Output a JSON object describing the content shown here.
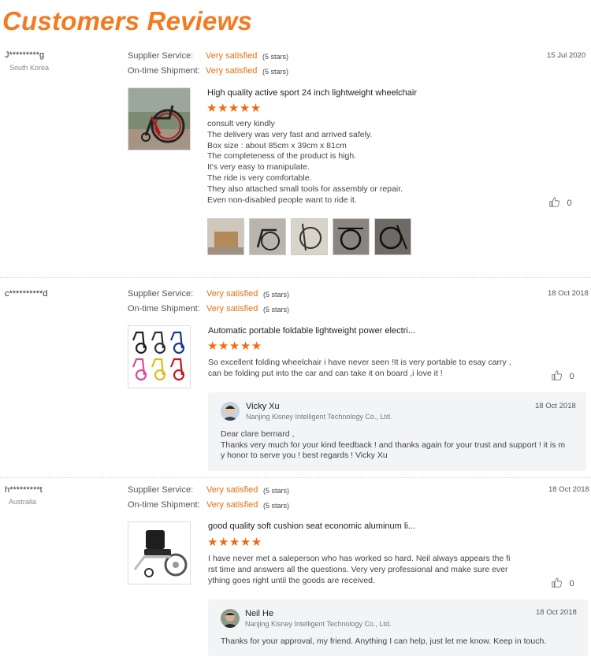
{
  "page_title": "Customers Reviews",
  "reviews": [
    {
      "user": "J*********g",
      "country": "South Korea",
      "supplier_label": "Supplier Service:",
      "supplier_value": "Very satisfied",
      "supplier_stars": "(5 stars)",
      "shipment_label": "On-time Shipment:",
      "shipment_value": "Very satisfied",
      "shipment_stars": "(5 stars)",
      "date": "15 Jul 2020",
      "product_title": "High quality active sport 24 inch lightweight wheelchair",
      "rating": "★★★★★",
      "rating_value": 5,
      "lines": [
        "consult very kindly",
        "The delivery was very fast and arrived safely.",
        "Box size : about 85cm x 39cm x 81cm",
        "The completeness of the product is high.",
        "It's very easy to manipulate.",
        "The ride is very comfortable.",
        "They also attached small tools for assembly or repair.",
        "Even non-disabled people want to ride it."
      ],
      "likes": "0"
    },
    {
      "user": "c**********d",
      "supplier_label": "Supplier Service:",
      "supplier_value": "Very satisfied",
      "supplier_stars": "(5 stars)",
      "shipment_label": "On-time Shipment:",
      "shipment_value": "Very satisfied",
      "shipment_stars": "(5 stars)",
      "date": "18 Oct 2018",
      "product_title": "Automatic portable foldable lightweight power electri...",
      "rating": "★★★★★",
      "rating_value": 5,
      "lines": [
        "So excellent folding wheelchair i have never seen !It is very portable to esay carry ,",
        "can be folding put into the car and can take it on board ,i love it !"
      ],
      "likes": "0",
      "reply": {
        "name": "Vicky Xu",
        "company": "Nanjing Kisney Intelligent Technology Co., Ltd.",
        "date": "18 Oct 2018",
        "lines": [
          "Dear clare bernard ,",
          "Thanks very much for your kind feedback ! and thanks again for your trust and support ! it is m",
          "y honor to serve you ! best regards ! Vicky Xu"
        ]
      }
    },
    {
      "user": "h*********t",
      "country": "Australia",
      "supplier_label": "Supplier Service:",
      "supplier_value": "Very satisfied",
      "supplier_stars": "(5 stars)",
      "shipment_label": "On-time Shipment:",
      "shipment_value": "Very satisfied",
      "shipment_stars": "(5 stars)",
      "date": "18 Oct 2018",
      "product_title": "good quality soft cushion seat economic aluminum li...",
      "rating": "★★★★★",
      "rating_value": 5,
      "lines": [
        "I have never met a saleperson who has worked so hard. Neil always appears the fi",
        "rst time and answers all the questions. Very very professional and make sure ever",
        "ything goes right until the goods are received."
      ],
      "likes": "0",
      "reply": {
        "name": "Neil He",
        "company": "Nanjing Kisney Intelligent Technology Co., Ltd.",
        "date": "18 Oct 2018",
        "lines": [
          "Thanks for your approval, my friend.  Anything I can help, just let me know. Keep in touch."
        ]
      }
    }
  ],
  "icons": {
    "like": "thumbs-up-icon",
    "star": "star-icon"
  },
  "colors": {
    "accent": "#f47a1f",
    "star": "#f26a0f",
    "satisfied": "#e66f12"
  }
}
